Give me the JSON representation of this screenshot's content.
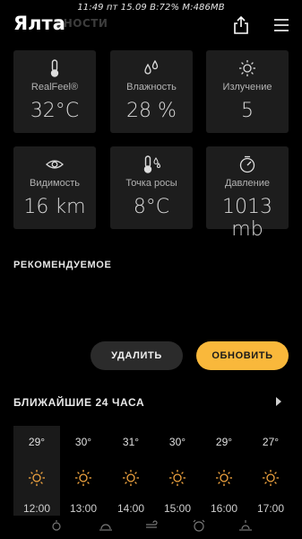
{
  "status_bar": {
    "text": "11:49 пт 15.09 B:72% M:486MB"
  },
  "header": {
    "city": "Ялта",
    "section_under": "ЕНОСТИ"
  },
  "details": [
    {
      "label": "RealFeel®",
      "value": "32°C",
      "icon": "thermometer-icon"
    },
    {
      "label": "Влажность",
      "value": "28 %",
      "icon": "droplets-icon"
    },
    {
      "label": "Излучение",
      "value": "5",
      "icon": "sun-icon"
    },
    {
      "label": "Видимость",
      "value": "16 km",
      "icon": "eye-icon"
    },
    {
      "label": "Точка росы",
      "value": "8°C",
      "icon": "dew-point-icon"
    },
    {
      "label": "Давление",
      "value": "1013 mb",
      "icon": "gauge-icon"
    }
  ],
  "recommended": {
    "title": "РЕКОМЕНДУЕМОЕ"
  },
  "buttons": {
    "delete": "УДАЛИТЬ",
    "update": "ОБНОВИТЬ"
  },
  "colors": {
    "accent": "#f9b83b",
    "sun": "#f2a540",
    "tile": "#1d1d1d"
  },
  "hourly": {
    "title": "БЛИЖАЙШИЕ 24 ЧАСА",
    "items": [
      {
        "temp": "29°",
        "time": "12:00",
        "icon": "sun-icon"
      },
      {
        "temp": "30°",
        "time": "13:00",
        "icon": "sun-icon"
      },
      {
        "temp": "31°",
        "time": "14:00",
        "icon": "sun-icon"
      },
      {
        "temp": "30°",
        "time": "15:00",
        "icon": "sun-icon"
      },
      {
        "temp": "29°",
        "time": "16:00",
        "icon": "sun-icon"
      },
      {
        "temp": "27°",
        "time": "17:00",
        "icon": "sun-icon"
      }
    ]
  },
  "bottom_nav": [
    "weather-icon",
    "sunrise-icon",
    "wind-icon",
    "alarm-icon",
    "sunset-icon"
  ]
}
